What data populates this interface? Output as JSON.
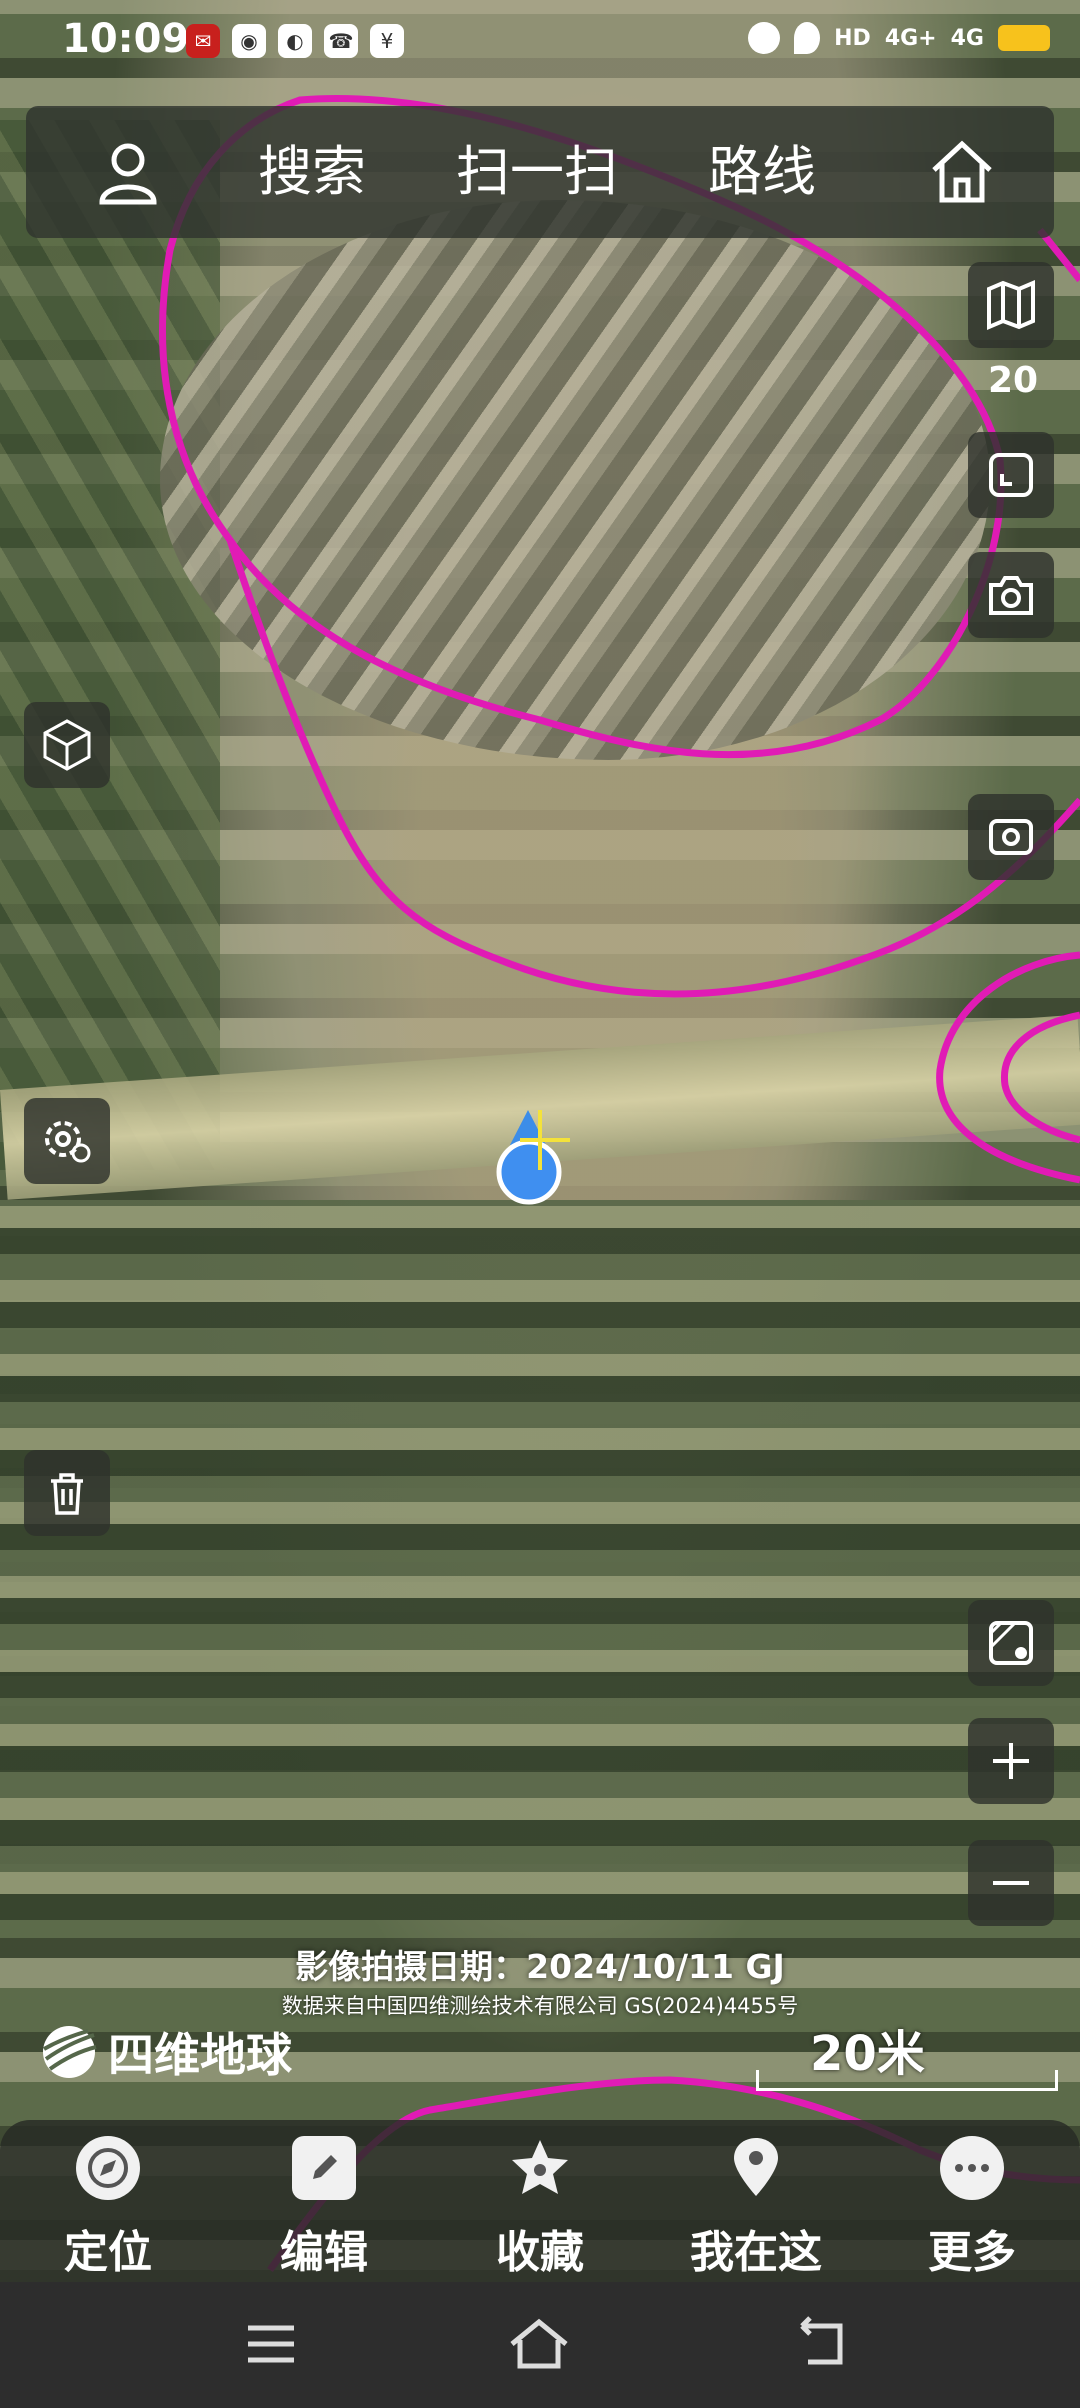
{
  "status_bar": {
    "time": "10:09",
    "net_label_1": "HD",
    "net_label_2": "4G+",
    "net_label_3": "4G",
    "battery_color": "#f7c21c",
    "icons": [
      "app-badge-icon",
      "wechat-icon",
      "browser-icon",
      "missed-call-icon",
      "yuan-icon",
      "alarm-icon",
      "location-icon"
    ]
  },
  "topbar": {
    "profile_icon": "user-icon",
    "search_label": "搜索",
    "scan_label": "扫一扫",
    "route_label": "路线",
    "home_icon": "home-icon"
  },
  "map": {
    "zoom_level": "20",
    "overlay_color": "#e01bb5",
    "imagery_date": "影像拍摄日期：2024/10/11 GJ",
    "data_source": "数据来自中国四维测绘技术有限公司 GS(2024)4455号",
    "brand": "四维地球",
    "scale_label": "20米"
  },
  "right_controls": [
    "map-layers-icon",
    "fullscreen-icon",
    "camera-icon",
    "screen-capture-icon",
    "map-pin-tool-icon",
    "zoom-in-icon",
    "zoom-out-icon"
  ],
  "left_controls": [
    "3d-view-icon",
    "settings-icon",
    "trash-icon"
  ],
  "bottom_nav": [
    {
      "label": "定位",
      "icon": "compass-icon"
    },
    {
      "label": "编辑",
      "icon": "edit-icon"
    },
    {
      "label": "收藏",
      "icon": "star-icon"
    },
    {
      "label": "我在这",
      "icon": "location-pin-icon"
    },
    {
      "label": "更多",
      "icon": "more-icon"
    }
  ],
  "system_nav": [
    "menu-icon",
    "home-nav-icon",
    "back-icon"
  ]
}
